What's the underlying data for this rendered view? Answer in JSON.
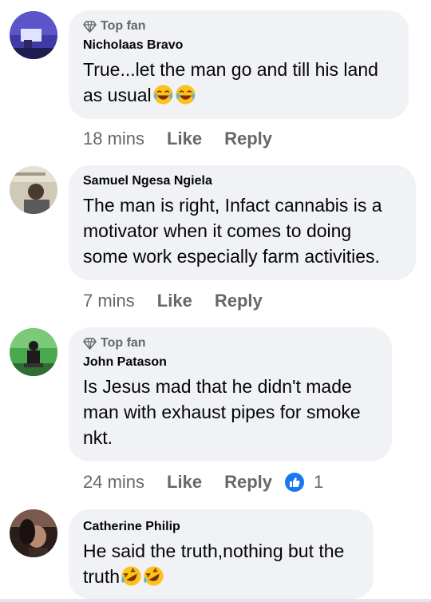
{
  "comments": [
    {
      "badge": "Top fan",
      "name": "Nicholaas Bravo",
      "text": "True...let the man go and till his land as usual",
      "emoji": "laughing-crying",
      "time": "18 mins",
      "like": "Like",
      "reply": "Reply"
    },
    {
      "badge": "",
      "name": "Samuel Ngesa Ngiela",
      "text": "The man is right, Infact cannabis is a motivator when it comes to doing some work especially farm activities.",
      "time": "7 mins",
      "like": "Like",
      "reply": "Reply"
    },
    {
      "badge": "Top fan",
      "name": "John Patason",
      "text": "Is Jesus mad that he didn't made man with exhaust pipes for smoke nkt.",
      "time": "24 mins",
      "like": "Like",
      "reply": "Reply",
      "reaction_count": "1"
    },
    {
      "badge": "",
      "name": "Catherine Philip",
      "text": "He said the truth,nothing but the truth",
      "emoji": "rolling-laughing",
      "time": "",
      "like": "",
      "reply": ""
    }
  ],
  "colors": {
    "bubble": "#f0f2f5",
    "secondary_text": "#65676b",
    "like_blue": "#1877f2"
  }
}
